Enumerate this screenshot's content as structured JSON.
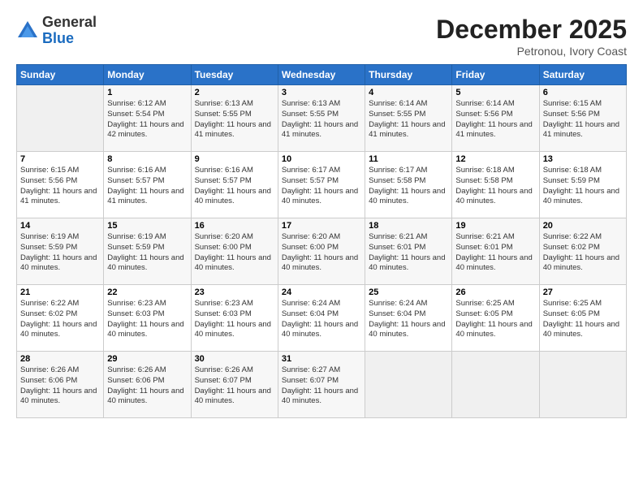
{
  "header": {
    "logo_general": "General",
    "logo_blue": "Blue",
    "month_year": "December 2025",
    "location": "Petronou, Ivory Coast"
  },
  "weekdays": [
    "Sunday",
    "Monday",
    "Tuesday",
    "Wednesday",
    "Thursday",
    "Friday",
    "Saturday"
  ],
  "weeks": [
    [
      {
        "day": "",
        "empty": true
      },
      {
        "day": "1",
        "sunrise": "Sunrise: 6:12 AM",
        "sunset": "Sunset: 5:54 PM",
        "daylight": "Daylight: 11 hours and 42 minutes."
      },
      {
        "day": "2",
        "sunrise": "Sunrise: 6:13 AM",
        "sunset": "Sunset: 5:55 PM",
        "daylight": "Daylight: 11 hours and 41 minutes."
      },
      {
        "day": "3",
        "sunrise": "Sunrise: 6:13 AM",
        "sunset": "Sunset: 5:55 PM",
        "daylight": "Daylight: 11 hours and 41 minutes."
      },
      {
        "day": "4",
        "sunrise": "Sunrise: 6:14 AM",
        "sunset": "Sunset: 5:55 PM",
        "daylight": "Daylight: 11 hours and 41 minutes."
      },
      {
        "day": "5",
        "sunrise": "Sunrise: 6:14 AM",
        "sunset": "Sunset: 5:56 PM",
        "daylight": "Daylight: 11 hours and 41 minutes."
      },
      {
        "day": "6",
        "sunrise": "Sunrise: 6:15 AM",
        "sunset": "Sunset: 5:56 PM",
        "daylight": "Daylight: 11 hours and 41 minutes."
      }
    ],
    [
      {
        "day": "7",
        "sunrise": "Sunrise: 6:15 AM",
        "sunset": "Sunset: 5:56 PM",
        "daylight": "Daylight: 11 hours and 41 minutes."
      },
      {
        "day": "8",
        "sunrise": "Sunrise: 6:16 AM",
        "sunset": "Sunset: 5:57 PM",
        "daylight": "Daylight: 11 hours and 41 minutes."
      },
      {
        "day": "9",
        "sunrise": "Sunrise: 6:16 AM",
        "sunset": "Sunset: 5:57 PM",
        "daylight": "Daylight: 11 hours and 40 minutes."
      },
      {
        "day": "10",
        "sunrise": "Sunrise: 6:17 AM",
        "sunset": "Sunset: 5:57 PM",
        "daylight": "Daylight: 11 hours and 40 minutes."
      },
      {
        "day": "11",
        "sunrise": "Sunrise: 6:17 AM",
        "sunset": "Sunset: 5:58 PM",
        "daylight": "Daylight: 11 hours and 40 minutes."
      },
      {
        "day": "12",
        "sunrise": "Sunrise: 6:18 AM",
        "sunset": "Sunset: 5:58 PM",
        "daylight": "Daylight: 11 hours and 40 minutes."
      },
      {
        "day": "13",
        "sunrise": "Sunrise: 6:18 AM",
        "sunset": "Sunset: 5:59 PM",
        "daylight": "Daylight: 11 hours and 40 minutes."
      }
    ],
    [
      {
        "day": "14",
        "sunrise": "Sunrise: 6:19 AM",
        "sunset": "Sunset: 5:59 PM",
        "daylight": "Daylight: 11 hours and 40 minutes."
      },
      {
        "day": "15",
        "sunrise": "Sunrise: 6:19 AM",
        "sunset": "Sunset: 5:59 PM",
        "daylight": "Daylight: 11 hours and 40 minutes."
      },
      {
        "day": "16",
        "sunrise": "Sunrise: 6:20 AM",
        "sunset": "Sunset: 6:00 PM",
        "daylight": "Daylight: 11 hours and 40 minutes."
      },
      {
        "day": "17",
        "sunrise": "Sunrise: 6:20 AM",
        "sunset": "Sunset: 6:00 PM",
        "daylight": "Daylight: 11 hours and 40 minutes."
      },
      {
        "day": "18",
        "sunrise": "Sunrise: 6:21 AM",
        "sunset": "Sunset: 6:01 PM",
        "daylight": "Daylight: 11 hours and 40 minutes."
      },
      {
        "day": "19",
        "sunrise": "Sunrise: 6:21 AM",
        "sunset": "Sunset: 6:01 PM",
        "daylight": "Daylight: 11 hours and 40 minutes."
      },
      {
        "day": "20",
        "sunrise": "Sunrise: 6:22 AM",
        "sunset": "Sunset: 6:02 PM",
        "daylight": "Daylight: 11 hours and 40 minutes."
      }
    ],
    [
      {
        "day": "21",
        "sunrise": "Sunrise: 6:22 AM",
        "sunset": "Sunset: 6:02 PM",
        "daylight": "Daylight: 11 hours and 40 minutes."
      },
      {
        "day": "22",
        "sunrise": "Sunrise: 6:23 AM",
        "sunset": "Sunset: 6:03 PM",
        "daylight": "Daylight: 11 hours and 40 minutes."
      },
      {
        "day": "23",
        "sunrise": "Sunrise: 6:23 AM",
        "sunset": "Sunset: 6:03 PM",
        "daylight": "Daylight: 11 hours and 40 minutes."
      },
      {
        "day": "24",
        "sunrise": "Sunrise: 6:24 AM",
        "sunset": "Sunset: 6:04 PM",
        "daylight": "Daylight: 11 hours and 40 minutes."
      },
      {
        "day": "25",
        "sunrise": "Sunrise: 6:24 AM",
        "sunset": "Sunset: 6:04 PM",
        "daylight": "Daylight: 11 hours and 40 minutes."
      },
      {
        "day": "26",
        "sunrise": "Sunrise: 6:25 AM",
        "sunset": "Sunset: 6:05 PM",
        "daylight": "Daylight: 11 hours and 40 minutes."
      },
      {
        "day": "27",
        "sunrise": "Sunrise: 6:25 AM",
        "sunset": "Sunset: 6:05 PM",
        "daylight": "Daylight: 11 hours and 40 minutes."
      }
    ],
    [
      {
        "day": "28",
        "sunrise": "Sunrise: 6:26 AM",
        "sunset": "Sunset: 6:06 PM",
        "daylight": "Daylight: 11 hours and 40 minutes."
      },
      {
        "day": "29",
        "sunrise": "Sunrise: 6:26 AM",
        "sunset": "Sunset: 6:06 PM",
        "daylight": "Daylight: 11 hours and 40 minutes."
      },
      {
        "day": "30",
        "sunrise": "Sunrise: 6:26 AM",
        "sunset": "Sunset: 6:07 PM",
        "daylight": "Daylight: 11 hours and 40 minutes."
      },
      {
        "day": "31",
        "sunrise": "Sunrise: 6:27 AM",
        "sunset": "Sunset: 6:07 PM",
        "daylight": "Daylight: 11 hours and 40 minutes."
      },
      {
        "day": "",
        "empty": true
      },
      {
        "day": "",
        "empty": true
      },
      {
        "day": "",
        "empty": true
      }
    ]
  ]
}
